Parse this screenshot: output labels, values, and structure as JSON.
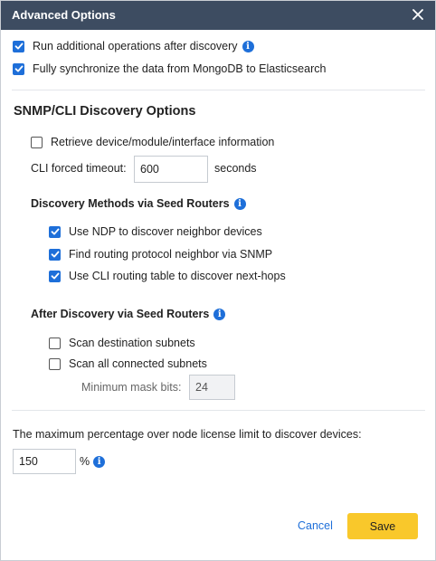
{
  "dialog": {
    "title": "Advanced Options"
  },
  "general": {
    "run_additional": {
      "label": "Run additional operations after discovery",
      "checked": true
    },
    "sync_mongo": {
      "label": "Fully synchronize the data from MongoDB to Elasticsearch",
      "checked": true
    }
  },
  "snmp_cli": {
    "title": "SNMP/CLI Discovery Options",
    "retrieve_info": {
      "label": "Retrieve device/module/interface information",
      "checked": false
    },
    "cli_timeout": {
      "label": "CLI forced timeout:",
      "value": "600",
      "unit": "seconds"
    }
  },
  "discovery_methods": {
    "title": "Discovery Methods via Seed Routers",
    "items": [
      {
        "label": "Use NDP to discover neighbor devices",
        "checked": true
      },
      {
        "label": "Find routing protocol neighbor via SNMP",
        "checked": true
      },
      {
        "label": "Use CLI routing table to discover next-hops",
        "checked": true
      }
    ]
  },
  "after_discovery": {
    "title": "After Discovery via Seed Routers",
    "scan_destination": {
      "label": "Scan destination subnets",
      "checked": false
    },
    "scan_connected": {
      "label": "Scan all connected subnets",
      "checked": false
    },
    "min_mask": {
      "label": "Minimum mask bits:",
      "value": "24"
    }
  },
  "license": {
    "label": "The maximum percentage over node license limit to discover devices:",
    "value": "150",
    "unit": "%"
  },
  "footer": {
    "cancel_label": "Cancel",
    "save_label": "Save"
  },
  "icons": {
    "info": "info-icon",
    "close": "close-icon",
    "check": "checkmark-icon"
  },
  "colors": {
    "title_bar": "#3d4c61",
    "accent": "#1e6fd9",
    "save_button": "#f9c82b"
  }
}
